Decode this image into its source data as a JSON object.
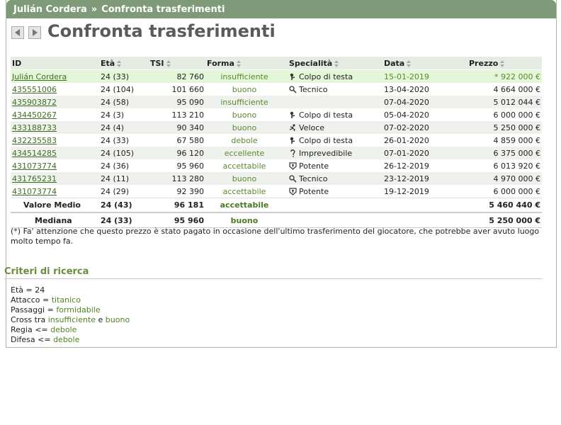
{
  "header": {
    "player": "Julián Cordera",
    "separator": "»",
    "section": "Confronta trasferimenti"
  },
  "page_title": "Confronta trasferimenti",
  "table": {
    "columns": [
      "ID",
      "Età",
      "TSI",
      "Forma",
      "Specialità",
      "Data",
      "Prezzo"
    ],
    "rows": [
      {
        "id": "Julián Cordera",
        "eta": "24 (33)",
        "tsi": "82 760",
        "forma": "insufficiente",
        "spec": "Colpo di testa",
        "spec_icon": "head-icon",
        "data": "15-01-2019",
        "prezzo": "* 922 000 €"
      },
      {
        "id": "435551006",
        "eta": "24 (104)",
        "tsi": "101 660",
        "forma": "buono",
        "spec": "Tecnico",
        "spec_icon": "technical-icon",
        "data": "13-04-2020",
        "prezzo": "4 664 000 €"
      },
      {
        "id": "435903872",
        "eta": "24 (58)",
        "tsi": "95 090",
        "forma": "insufficiente",
        "spec": "",
        "spec_icon": "",
        "data": "07-04-2020",
        "prezzo": "5 012 044 €"
      },
      {
        "id": "434450267",
        "eta": "24 (3)",
        "tsi": "113 210",
        "forma": "buono",
        "spec": "Colpo di testa",
        "spec_icon": "head-icon",
        "data": "05-04-2020",
        "prezzo": "6 000 000 €"
      },
      {
        "id": "433188733",
        "eta": "24 (4)",
        "tsi": "90 340",
        "forma": "buono",
        "spec": "Veloce",
        "spec_icon": "quick-icon",
        "data": "07-02-2020",
        "prezzo": "5 250 000 €"
      },
      {
        "id": "432235583",
        "eta": "24 (33)",
        "tsi": "67 580",
        "forma": "debole",
        "spec": "Colpo di testa",
        "spec_icon": "head-icon",
        "data": "26-01-2020",
        "prezzo": "4 859 000 €"
      },
      {
        "id": "434514285",
        "eta": "24 (105)",
        "tsi": "96 120",
        "forma": "eccellente",
        "spec": "Imprevedibile",
        "spec_icon": "unpredictable-icon",
        "data": "07-01-2020",
        "prezzo": "6 375 000 €"
      },
      {
        "id": "431073774",
        "eta": "24 (36)",
        "tsi": "95 960",
        "forma": "accettabile",
        "spec": "Potente",
        "spec_icon": "powerful-icon",
        "data": "26-12-2019",
        "prezzo": "6 013 920 €"
      },
      {
        "id": "431765231",
        "eta": "24 (11)",
        "tsi": "113 280",
        "forma": "buono",
        "spec": "Tecnico",
        "spec_icon": "technical-icon",
        "data": "23-12-2019",
        "prezzo": "4 970 000 €"
      },
      {
        "id": "431073774",
        "eta": "24 (29)",
        "tsi": "92 390",
        "forma": "accettabile",
        "spec": "Potente",
        "spec_icon": "powerful-icon",
        "data": "19-12-2019",
        "prezzo": "6 000 000 €"
      }
    ],
    "average": {
      "label": "Valore Medio",
      "eta": "24 (43)",
      "tsi": "96 181",
      "forma": "accettabile",
      "prezzo": "5 460 440 €"
    },
    "median": {
      "label": "Mediana",
      "eta": "24 (33)",
      "tsi": "95 960",
      "forma": "buono",
      "prezzo": "5 250 000 €"
    }
  },
  "note": "(*) Fa' attenzione che questo prezzo è stato pagato in occasione dell'ultimo trasferimento del giocatore, che potrebbe aver avuto luogo molto tempo fa.",
  "criteria": {
    "title": "Criteri di ricerca",
    "lines": [
      {
        "label": "Età = 24",
        "value": "",
        "sep": "",
        "value2": ""
      },
      {
        "label": "Attacco = ",
        "value": "titanico",
        "sep": "",
        "value2": ""
      },
      {
        "label": "Passaggi = ",
        "value": "formidabile",
        "sep": "",
        "value2": ""
      },
      {
        "label": "Cross tra ",
        "value": "insufficiente",
        "sep": " e ",
        "value2": "buono"
      },
      {
        "label": "Regia <= ",
        "value": "debole",
        "sep": "",
        "value2": ""
      },
      {
        "label": "Difesa <= ",
        "value": "debole",
        "sep": "",
        "value2": ""
      }
    ]
  }
}
